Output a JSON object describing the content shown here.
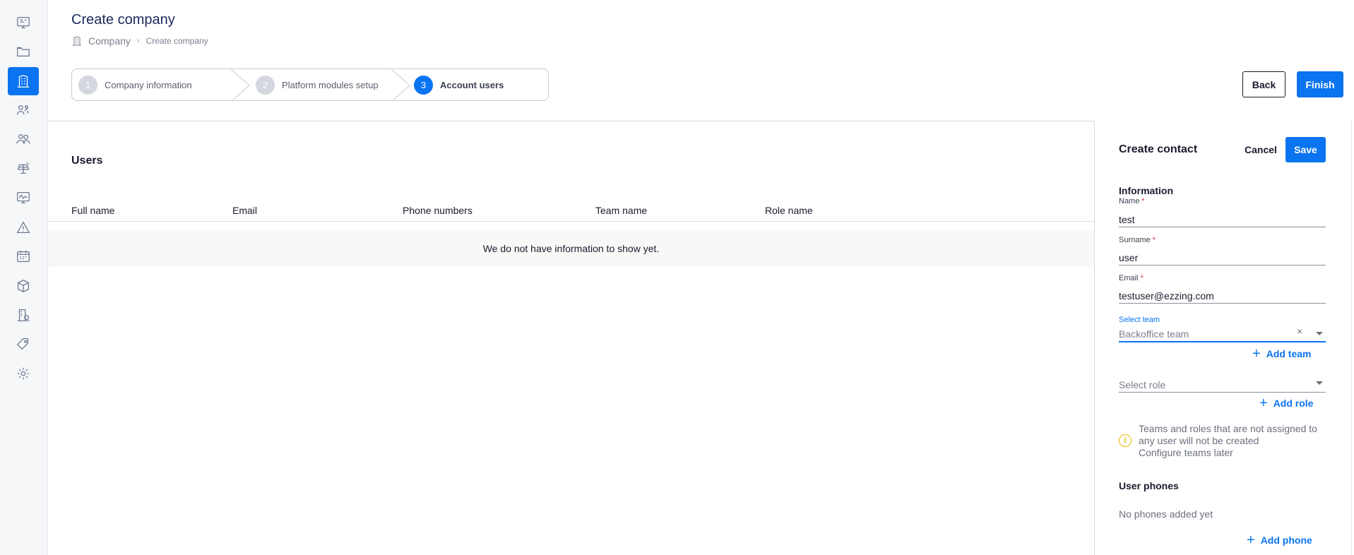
{
  "sidebar": {
    "items": [
      {
        "icon": "dashboard-icon"
      },
      {
        "icon": "folder-icon"
      },
      {
        "icon": "building-icon",
        "active": true
      },
      {
        "icon": "people-network-icon"
      },
      {
        "icon": "group-icon"
      },
      {
        "icon": "solar-panel-icon"
      },
      {
        "icon": "monitor-chart-icon"
      },
      {
        "icon": "warning-icon"
      },
      {
        "icon": "calendar-icon"
      },
      {
        "icon": "box-icon"
      },
      {
        "icon": "billing-icon"
      },
      {
        "icon": "tag-icon"
      },
      {
        "icon": "settings-gear-icon"
      }
    ]
  },
  "header": {
    "title": "Create company",
    "breadcrumb": {
      "first": "Company",
      "separator": "›",
      "second": "Create company"
    }
  },
  "stepper": {
    "steps": [
      {
        "number": "1",
        "label": "Company information"
      },
      {
        "number": "2",
        "label": "Platform modules setup"
      },
      {
        "number": "3",
        "label": "Account users",
        "active": true
      }
    ]
  },
  "actions": {
    "back": "Back",
    "finish": "Finish"
  },
  "users": {
    "title": "Users",
    "columns": [
      "Full name",
      "Email",
      "Phone numbers",
      "Team name",
      "Role name"
    ],
    "empty_message": "We do not have information to show yet."
  },
  "panel": {
    "title": "Create contact",
    "cancel": "Cancel",
    "save": "Save",
    "section_information": "Information",
    "name_label": "Name",
    "name_value": "test",
    "surname_label": "Surname",
    "surname_value": "user",
    "email_label": "Email",
    "email_value": "testuser@ezzing.com",
    "required_mark": "*",
    "team_label": "Select team",
    "team_placeholder": "Backoffice team",
    "add_team": "Add team",
    "role_placeholder": "Select role",
    "add_role": "Add role",
    "info_line1": "Teams and roles that are not assigned to any user will not be created",
    "info_line2": "Configure teams later",
    "section_phones": "User phones",
    "no_phones": "No phones added yet",
    "add_phone": "Add phone"
  },
  "colors": {
    "accent": "#0b74f0",
    "warning": "#e6b800"
  }
}
